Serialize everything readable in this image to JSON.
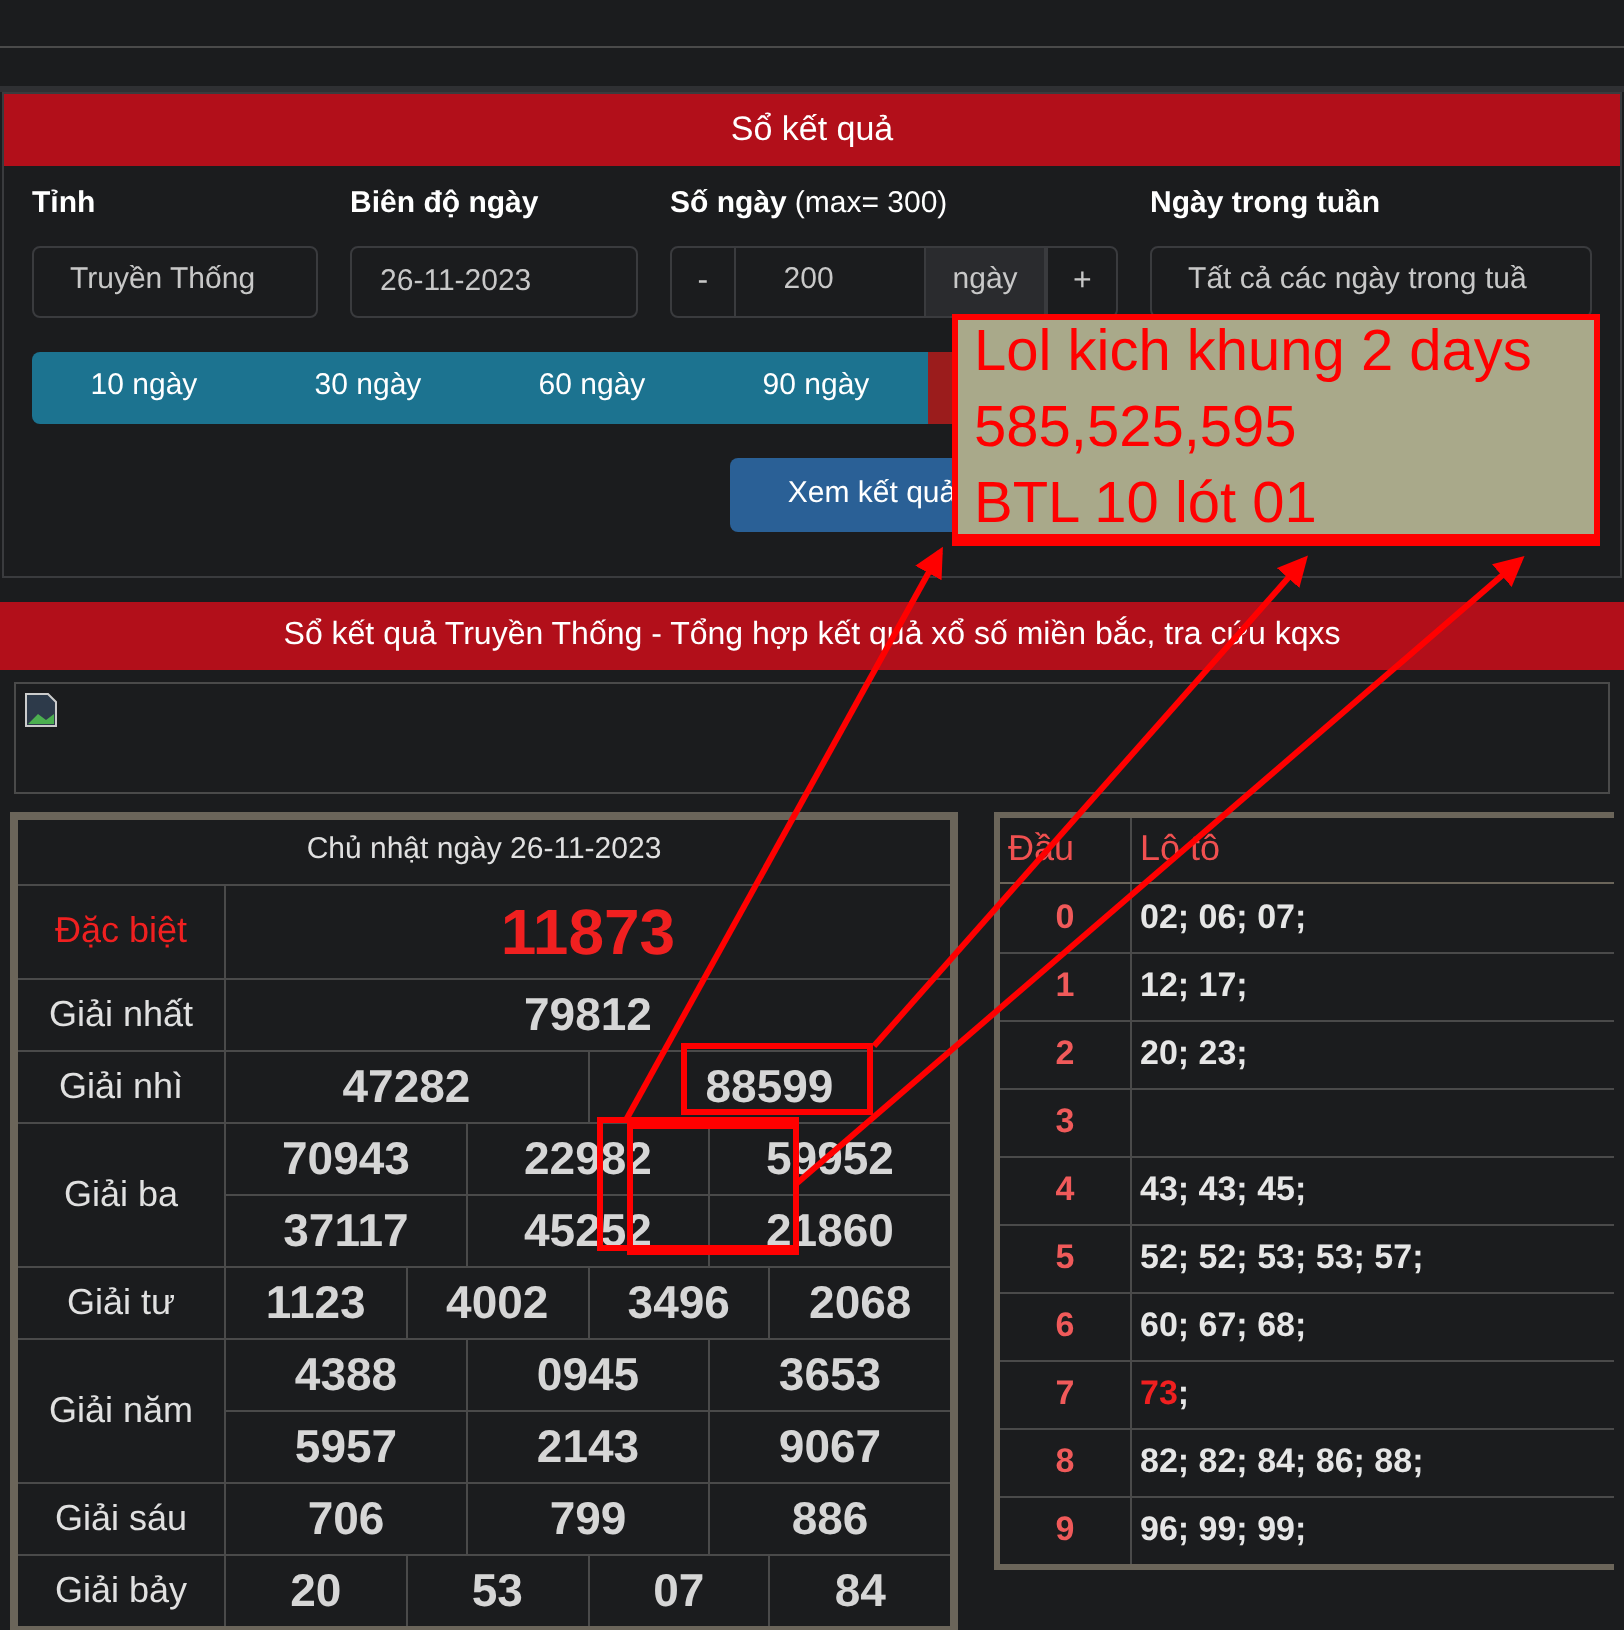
{
  "panel": {
    "title": "Sổ kết quả",
    "fields": [
      {
        "label": "Tỉnh",
        "value": "Truyền Thống",
        "kind": "select"
      },
      {
        "label": "Biên độ ngày",
        "value": "26-11-2023",
        "kind": "text"
      },
      {
        "label": "Số ngày",
        "hint": "(max= 300)",
        "value": "200",
        "unit": "ngày",
        "minus": "-",
        "plus": "+",
        "kind": "stepper"
      },
      {
        "label": "Ngày trong tuần",
        "value": "Tất cả các ngày trong tuầ",
        "kind": "select"
      }
    ],
    "ranges": [
      {
        "label": "10 ngày",
        "selected": false
      },
      {
        "label": "30 ngày",
        "selected": false
      },
      {
        "label": "60 ngày",
        "selected": false
      },
      {
        "label": "90 ngày",
        "selected": false
      },
      {
        "selected": true
      }
    ],
    "submit": "Xem kết quả"
  },
  "results_title": "Sổ kết quả Truyền Thống - Tổng hợp kết quả xổ số miền bắc, tra cứu kqxs",
  "results": {
    "date": "Chủ nhật ngày 26-11-2023",
    "prizes": [
      {
        "name": "Đặc biệt",
        "kind": "special",
        "rows": [
          [
            "11873"
          ]
        ]
      },
      {
        "name": "Giải nhất",
        "kind": "normal",
        "rows": [
          [
            "79812"
          ]
        ]
      },
      {
        "name": "Giải nhì",
        "kind": "normal",
        "rows": [
          [
            "47282",
            "88599"
          ]
        ]
      },
      {
        "name": "Giải ba",
        "kind": "normal",
        "rows": [
          [
            "70943",
            "22982",
            "59952"
          ],
          [
            "37117",
            "45252",
            "21860"
          ]
        ]
      },
      {
        "name": "Giải tư",
        "kind": "normal",
        "rows": [
          [
            "1123",
            "4002",
            "3496",
            "2068"
          ]
        ]
      },
      {
        "name": "Giải năm",
        "kind": "normal",
        "rows": [
          [
            "4388",
            "0945",
            "3653"
          ],
          [
            "5957",
            "2143",
            "9067"
          ]
        ]
      },
      {
        "name": "Giải sáu",
        "kind": "normal",
        "rows": [
          [
            "706",
            "799",
            "886"
          ]
        ]
      },
      {
        "name": "Giải bảy",
        "kind": "normal",
        "rows": [
          [
            "20",
            "53",
            "07",
            "84"
          ]
        ]
      }
    ]
  },
  "loto": {
    "columns": [
      "Đầu",
      "Lô tô"
    ],
    "rows": [
      {
        "head": "0",
        "parts": [
          {
            "text": "02; 06; 07;",
            "highlight": false
          }
        ]
      },
      {
        "head": "1",
        "parts": [
          {
            "text": "12; 17;",
            "highlight": false
          }
        ]
      },
      {
        "head": "2",
        "parts": [
          {
            "text": "20; 23;",
            "highlight": false
          }
        ]
      },
      {
        "head": "3",
        "parts": []
      },
      {
        "head": "4",
        "parts": [
          {
            "text": "43; 43; 45;",
            "highlight": false
          }
        ]
      },
      {
        "head": "5",
        "parts": [
          {
            "text": "52; 52; 53; 53; 57;",
            "highlight": false
          }
        ]
      },
      {
        "head": "6",
        "parts": [
          {
            "text": "60; 67; 68;",
            "highlight": false
          }
        ]
      },
      {
        "head": "7",
        "parts": [
          {
            "text": "73",
            "highlight": true
          },
          {
            "text": ";",
            "highlight": false
          }
        ]
      },
      {
        "head": "8",
        "parts": [
          {
            "text": "82; 82; 84; 86; 88;",
            "highlight": false
          }
        ]
      },
      {
        "head": "9",
        "parts": [
          {
            "text": "96; 99; 99;",
            "highlight": false
          }
        ]
      }
    ]
  },
  "note": {
    "lines": [
      "Lol kich khung 2 days",
      "585,525,595",
      "BTL 10 lót 01"
    ]
  }
}
